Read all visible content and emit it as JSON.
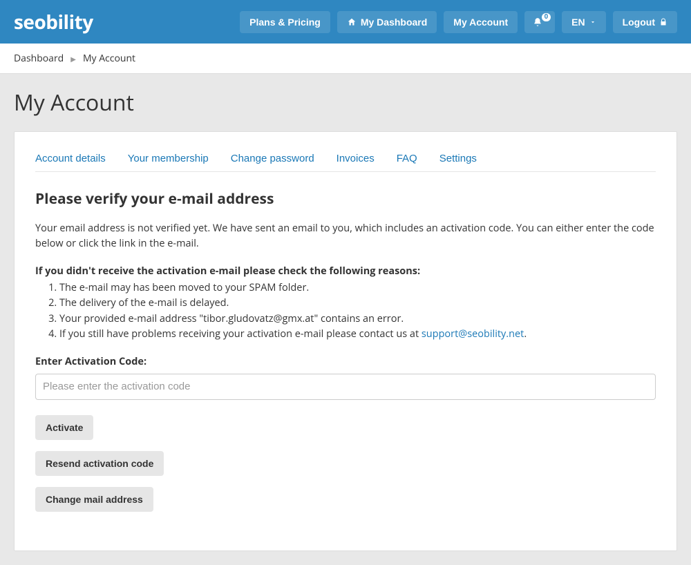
{
  "brand": "seobility",
  "nav": {
    "plans": "Plans & Pricing",
    "dashboard": "My Dashboard",
    "account": "My Account",
    "lang": "EN",
    "logout": "Logout",
    "notif_count": "0"
  },
  "breadcrumb": {
    "root": "Dashboard",
    "current": "My Account"
  },
  "page_title": "My Account",
  "tabs": {
    "details": "Account details",
    "membership": "Your membership",
    "password": "Change password",
    "invoices": "Invoices",
    "faq": "FAQ",
    "settings": "Settings"
  },
  "verify": {
    "heading": "Please verify your e-mail address",
    "intro": "Your email address is not verified yet. We have sent an email to you, which includes an activation code. You can either enter the code below or click the link in the e-mail.",
    "reasons_title": "If you didn't receive the activation e-mail please check the following reasons:",
    "reasons": [
      "The e-mail may has been moved to your SPAM folder.",
      "The delivery of the e-mail is delayed.",
      "Your provided e-mail address \"tibor.gludovatz@gmx.at\" contains an error."
    ],
    "reason4_prefix": "If you still have problems receiving your activation e-mail please contact us at ",
    "support_email": "support@seobility.net",
    "reason4_suffix": ".",
    "field_label": "Enter Activation Code:",
    "placeholder": "Please enter the activation code",
    "activate": "Activate",
    "resend": "Resend activation code",
    "change_mail": "Change mail address"
  }
}
